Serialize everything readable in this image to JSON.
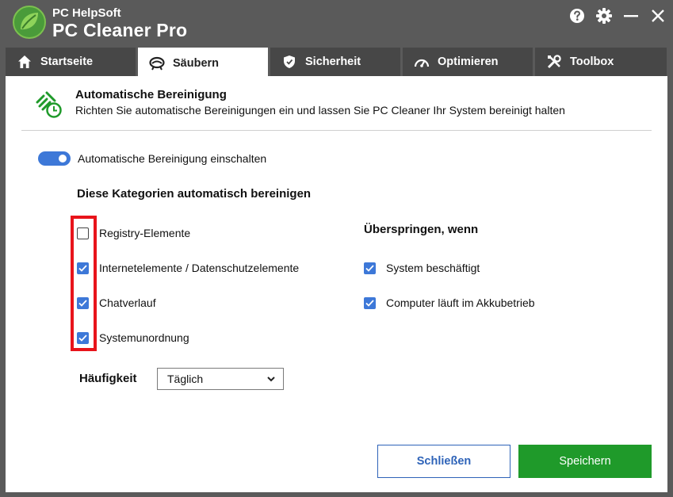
{
  "app": {
    "brand_small": "PC HelpSoft",
    "brand_big": "PC Cleaner Pro",
    "accent": "#3d78d8",
    "save_color": "#1f9a2a",
    "highlight_color": "#e8141b"
  },
  "window_controls": {
    "help_icon": "help-icon",
    "settings_icon": "gear-icon",
    "minimize_icon": "minimize-icon",
    "close_icon": "close-icon"
  },
  "tabs": [
    {
      "label": "Startseite",
      "icon": "home-icon",
      "active": false
    },
    {
      "label": "Säubern",
      "icon": "broom-icon",
      "active": true
    },
    {
      "label": "Sicherheit",
      "icon": "shield-icon",
      "active": false
    },
    {
      "label": "Optimieren",
      "icon": "speedometer-icon",
      "active": false
    },
    {
      "label": "Toolbox",
      "icon": "tools-icon",
      "active": false
    }
  ],
  "header": {
    "title": "Automatische Bereinigung",
    "subtitle": "Richten Sie automatische Bereinigungen ein und lassen Sie PC Cleaner Ihr System bereinigt halten"
  },
  "toggle": {
    "label": "Automatische Bereinigung einschalten",
    "on": true
  },
  "categories": {
    "title": "Diese Kategorien automatisch bereinigen",
    "items": [
      {
        "label": "Registry-Elemente",
        "checked": false
      },
      {
        "label": "Internetelemente / Datenschutzelemente",
        "checked": true
      },
      {
        "label": "Chatverlauf",
        "checked": true
      },
      {
        "label": "Systemunordnung",
        "checked": true
      }
    ]
  },
  "skip": {
    "title": "Überspringen, wenn",
    "items": [
      {
        "label": "System beschäftigt",
        "checked": true
      },
      {
        "label": "Computer läuft im Akkubetrieb",
        "checked": true
      }
    ]
  },
  "frequency": {
    "label": "Häufigkeit",
    "value": "Täglich"
  },
  "buttons": {
    "close": "Schließen",
    "save": "Speichern"
  }
}
